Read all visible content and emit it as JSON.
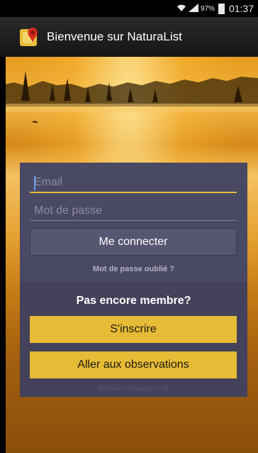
{
  "status_bar": {
    "battery": "97%",
    "time": "01:37"
  },
  "action_bar": {
    "title": "Bienvenue sur NaturaList"
  },
  "login": {
    "email_placeholder": "Email",
    "password_placeholder": "Mot de passe",
    "connect_label": "Me connecter",
    "forgot_label": "Mot de passe oublié ?"
  },
  "signup": {
    "prompt": "Pas encore membre?",
    "signup_label": "S'inscrire",
    "observations_label": "Aller aux observations"
  },
  "footer": {
    "version": "Biolovision NaturaList v0.44"
  },
  "colors": {
    "accent_yellow": "#e6bb35",
    "card": "#43425a"
  }
}
